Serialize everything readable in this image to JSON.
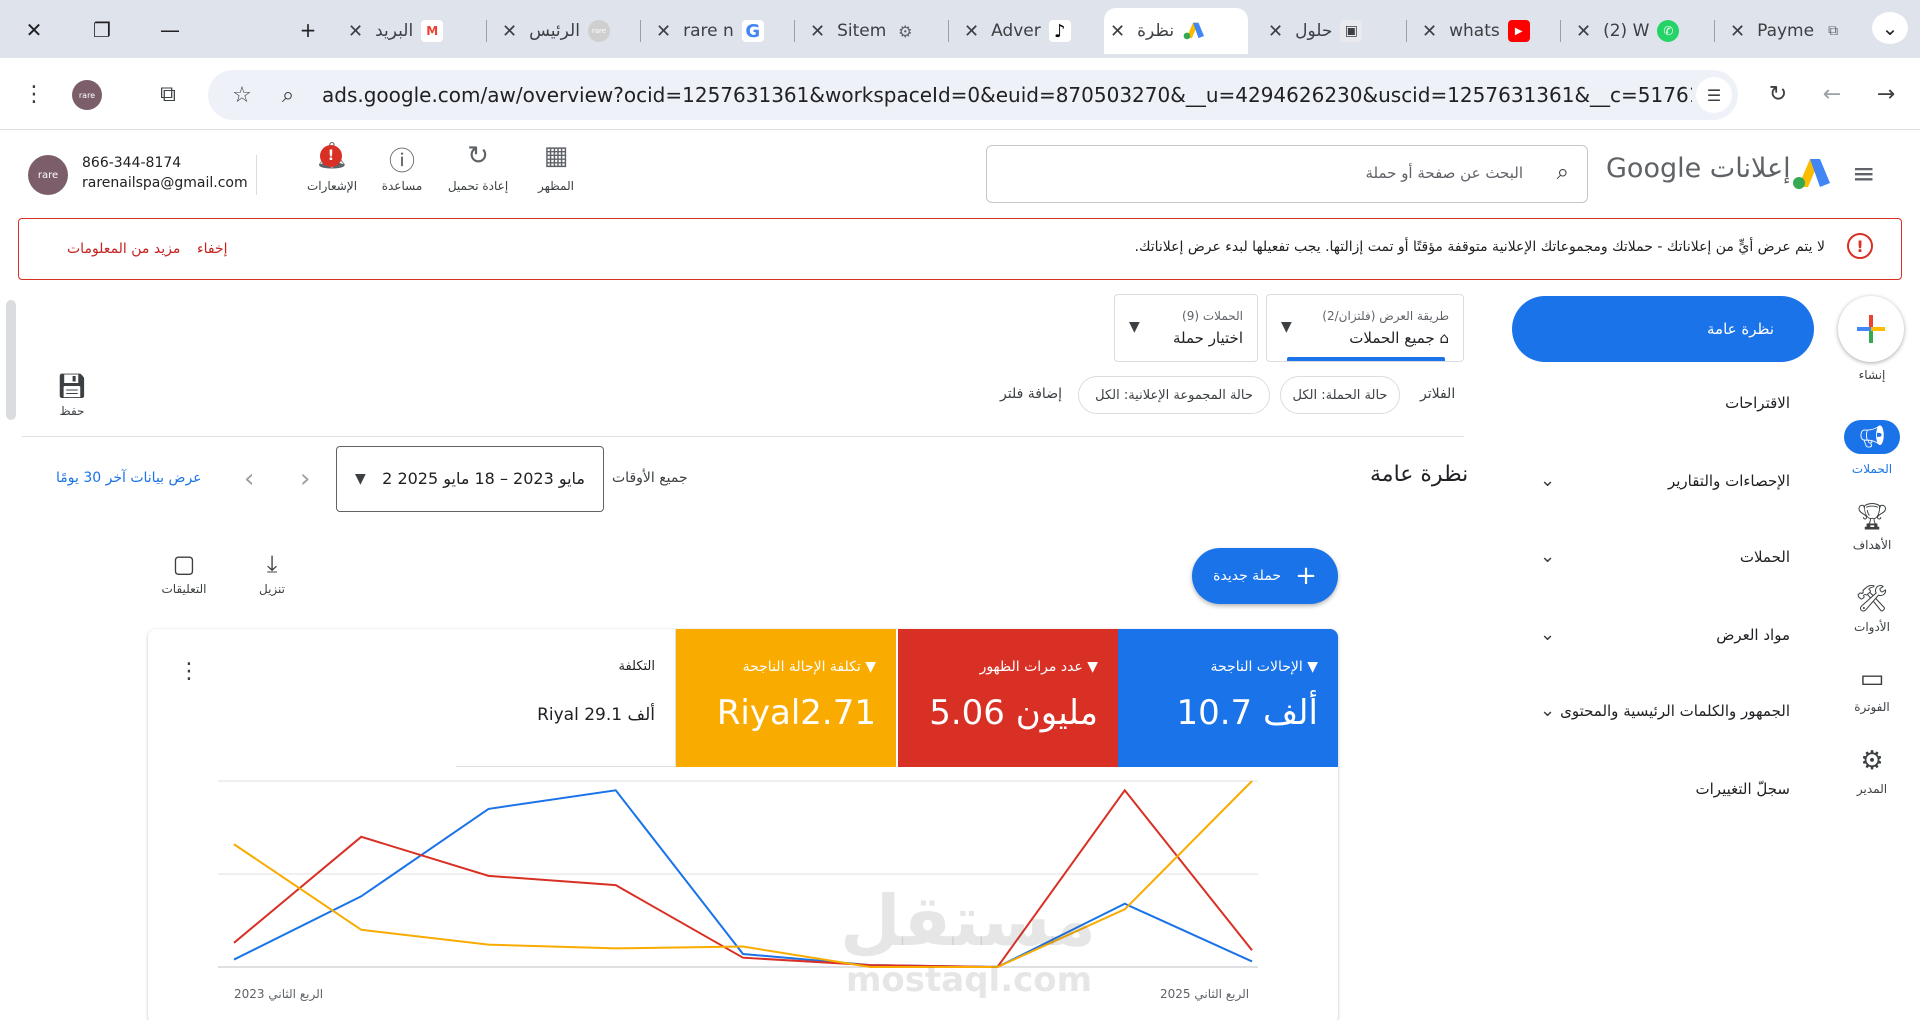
{
  "browser": {
    "tabs": [
      {
        "title": "البريد",
        "icon": "M"
      },
      {
        "title": "الرئيس",
        "icon": "rare"
      },
      {
        "title": "rare n",
        "icon": "G"
      },
      {
        "title": "Sitem",
        "icon": "⚙"
      },
      {
        "title": "Adver",
        "icon": "♪"
      },
      {
        "title": "نظرة",
        "icon": "▲"
      },
      {
        "title": "حلول",
        "icon": "▣"
      },
      {
        "title": "whats",
        "icon": "▶"
      },
      {
        "title": "(2) W",
        "icon": "✆"
      },
      {
        "title": "Payme",
        "icon": "⧉"
      }
    ],
    "url": "ads.google.com/aw/overview?ocid=1257631361&workspaceId=0&euid=870503270&__u=4294626230&uscid=1257631361&__c=5176130489&a...",
    "profile_label": "rare"
  },
  "header": {
    "account_avatar": "rare",
    "phone": "866-344-8174",
    "email": "rarenailspa@gmail.com",
    "notifications_badge": "!",
    "buttons": {
      "notifications": "الإشعارات",
      "help": "مساعدة",
      "reload": "إعادة تحميل",
      "appearance": "المظهر"
    },
    "search_placeholder": "البحث عن صفحة أو حملة",
    "logo_text": "إعلانات Google"
  },
  "alert": {
    "message": "لا يتم عرض أيٍّ من إعلاناتك - حملاتك ومجموعاتك الإعلانية متوقفة مؤقتًا أو تمت إزالتها. يجب تفعيلها لبدء عرض إعلاناتك.",
    "hide": "إخفاء",
    "more_info": "مزيد من المعلومات"
  },
  "rail": {
    "create": "إنشاء",
    "campaigns": "الحملات",
    "goals": "الأهداف",
    "tools": "الأدوات",
    "billing": "الفوترة",
    "admin": "المدير"
  },
  "nav": {
    "overview": "نظرة عامة",
    "recommendations": "الاقتراحات",
    "insights": "الإحصاءات والتقارير",
    "campaigns": "الحملات",
    "assets": "مواد العرض",
    "audiences": "الجمهور والكلمات الرئيسية والمحتوى",
    "change_history": "سجلّ التغييرات"
  },
  "view_selector": {
    "label": "طريقة العرض (فلتزان/2)",
    "value": "جميع الحملات"
  },
  "campaign_selector": {
    "label": "الحملات (9)",
    "value": "اختيار حملة"
  },
  "save_label": "حفظ",
  "filters": {
    "label": "الفلاتر",
    "chips": [
      "حالة الحملة: الكل",
      "حالة المجموعة الإعلانية: الكل"
    ],
    "add": "إضافة فلتر"
  },
  "overview_title": "نظرة عامة",
  "date": {
    "all_times": "جميع الأوقات",
    "range": "2 مايو 2023 – 18 مايو 2025",
    "last_30": "عرض بيانات آخر 30 يومًا"
  },
  "new_campaign": "حملة جديدة",
  "tools": {
    "download": "تنزيل",
    "feedback": "التعليقات"
  },
  "metrics": [
    {
      "name": "الإحالات الناجحة",
      "value": "10.7 ألف",
      "color": "#1a73e8"
    },
    {
      "name": "عدد مرات الظهور",
      "value": "5.06 مليون",
      "color": "#d93025"
    },
    {
      "name": "تكلفة الإحالة الناجحة",
      "value": "Riyal2.71",
      "color": "#f9ab00"
    },
    {
      "name": "التكلفة",
      "value": "Riyal 29.1 ألف",
      "color": ""
    }
  ],
  "chart_data": {
    "type": "line",
    "x": [
      "الربع الثاني 2023",
      "",
      "",
      "",
      "",
      "",
      "",
      "",
      "الربع الثاني 2025"
    ],
    "x_tick_labels": [
      "الربع الثاني 2023",
      "الربع الثاني 2025"
    ],
    "series": [
      {
        "name": "الإحالات الناجحة",
        "color": "#1a73e8",
        "values": [
          0.04,
          0.38,
          0.85,
          0.95,
          0.07,
          0.01,
          0.0,
          0.34,
          0.03
        ]
      },
      {
        "name": "عدد مرات الظهور",
        "color": "#d93025",
        "values": [
          0.13,
          0.7,
          0.49,
          0.44,
          0.05,
          0.01,
          0.0,
          0.95,
          0.09
        ]
      },
      {
        "name": "تكلفة الإحالة الناجحة",
        "color": "#f9ab00",
        "values": [
          0.66,
          0.2,
          0.12,
          0.1,
          0.11,
          0.0,
          0.0,
          0.31,
          1.0
        ]
      }
    ],
    "ylim": [
      0,
      1
    ],
    "grid": true
  },
  "watermark": {
    "text": "مستقل",
    "sub": "mostaql.com"
  }
}
